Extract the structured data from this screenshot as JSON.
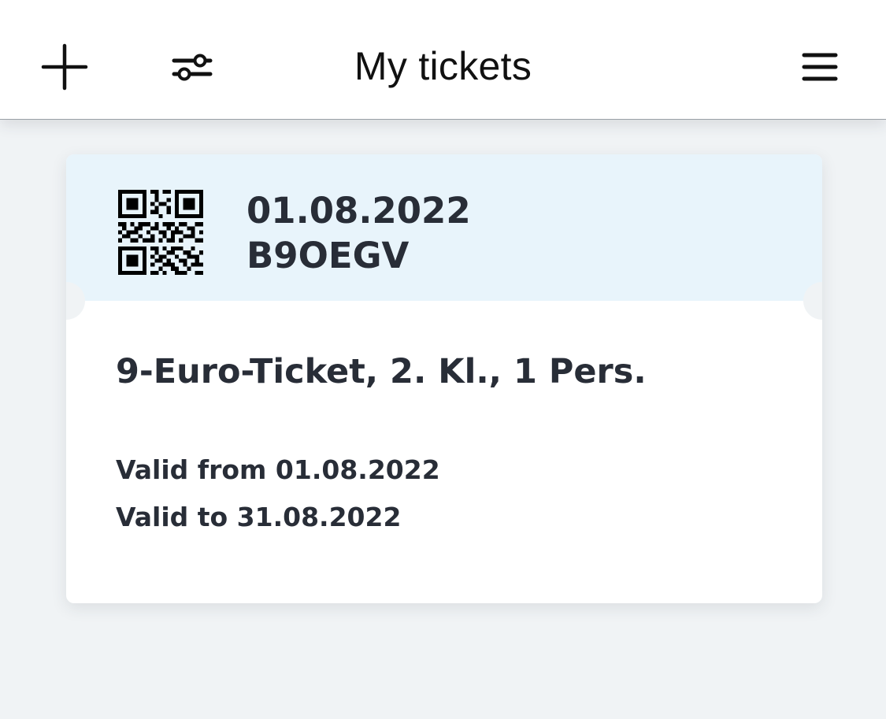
{
  "header": {
    "title": "My tickets",
    "add_icon": "plus-icon",
    "filter_icon": "sliders-icon",
    "menu_icon": "hamburger-menu-icon"
  },
  "ticket": {
    "date": "01.08.2022",
    "code": "B9OEGV",
    "name": "9-Euro-Ticket, 2. Kl., 1 Pers.",
    "valid_from": "Valid from 01.08.2022",
    "valid_to": "Valid to 31.08.2022",
    "qr_icon": "qr-code-icon"
  },
  "colors": {
    "background": "#f0f3f5",
    "ticket_header": "#e8f4fb",
    "text": "#282d37"
  }
}
